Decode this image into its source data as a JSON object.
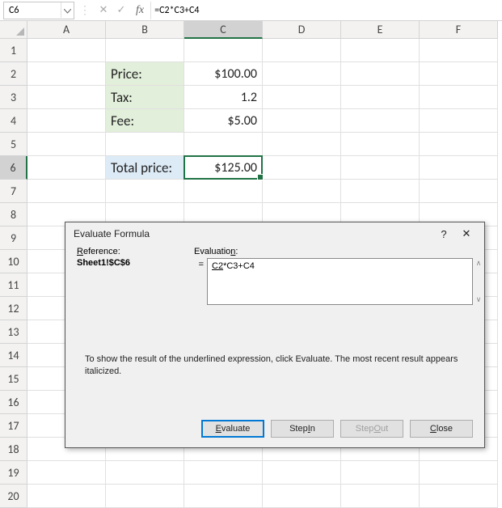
{
  "namebox": {
    "cell": "C6"
  },
  "formula_bar": {
    "formula": "=C2*C3+C4"
  },
  "columns": [
    "A",
    "B",
    "C",
    "D",
    "E",
    "F"
  ],
  "rows": [
    "1",
    "2",
    "3",
    "4",
    "5",
    "6",
    "7",
    "8",
    "9",
    "10",
    "11",
    "12",
    "13",
    "14",
    "15",
    "16",
    "17",
    "18",
    "19",
    "20"
  ],
  "selected_col": "C",
  "selected_row": "6",
  "cells": {
    "B2": "Price:",
    "C2": "$100.00",
    "B3": "Tax:",
    "C3": "1.2",
    "B4": "Fee:",
    "C4": "$5.00",
    "B6": "Total price:",
    "C6": "$125.00"
  },
  "dialog": {
    "title": "Evaluate Formula",
    "help": "?",
    "close": "✕",
    "ref_label_pre": "R",
    "ref_label_rest": "eference:",
    "ref_value": "Sheet1!$C$6",
    "eval_label_pre": "Evaluatio",
    "eval_label_u": "n",
    "eval_label_post": ":",
    "equals": "=",
    "eval_underlined": "C2",
    "eval_rest": "*C3+C4",
    "hint": "To show the result of the underlined expression, click Evaluate.  The most recent result appears italicized.",
    "buttons": {
      "evaluate_pre": "E",
      "evaluate_rest": "valuate",
      "stepin_pre": "Step ",
      "stepin_u": "I",
      "stepin_post": "n",
      "stepout_pre": "Step ",
      "stepout_u": "O",
      "stepout_post": "ut",
      "close_pre": "C",
      "close_rest": "lose"
    }
  }
}
